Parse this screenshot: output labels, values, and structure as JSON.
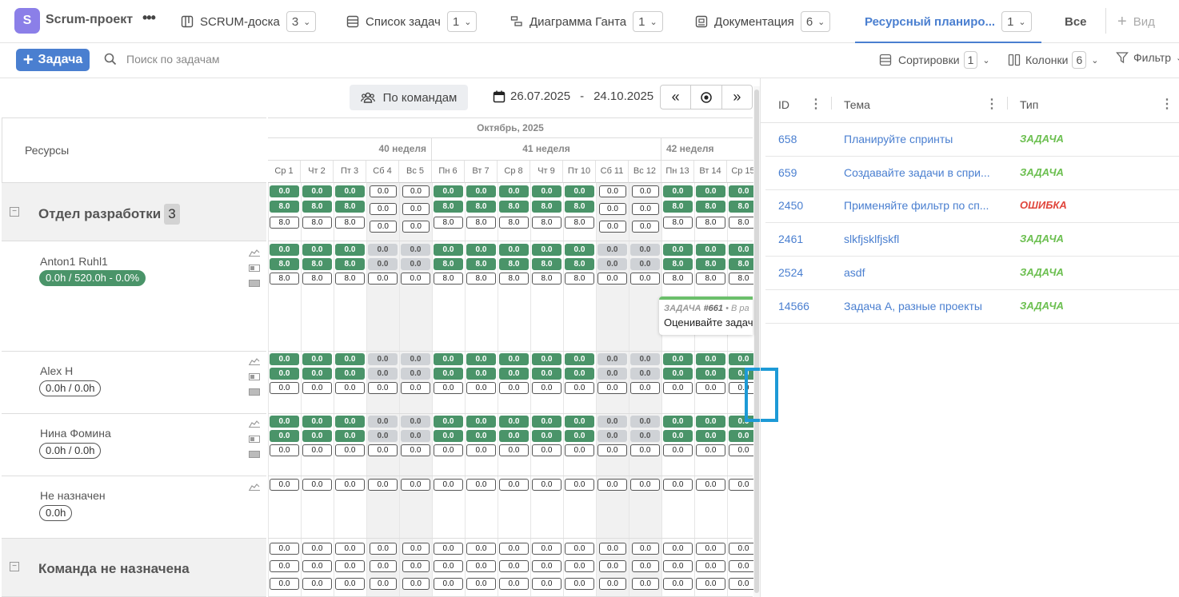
{
  "project": {
    "icon": "S",
    "name": "Scrum-проект",
    "more": "•••"
  },
  "tabs": [
    {
      "label": "SCRUM-доска",
      "count": "3",
      "icon": "board-icon"
    },
    {
      "label": "Список задач",
      "count": "1",
      "icon": "list-icon"
    },
    {
      "label": "Диаграмма Ганта",
      "count": "1",
      "icon": "gantt-icon"
    },
    {
      "label": "Документация",
      "count": "6",
      "icon": "docs-icon"
    },
    {
      "label": "Ресурсный планиро...",
      "count": "1",
      "icon": "",
      "active": true
    }
  ],
  "tab_all": "Все",
  "tab_view": "Вид",
  "toolbar": {
    "add_label": "Задача",
    "search_placeholder": "Поиск по задачам",
    "sort_label": "Сортировки",
    "sort_count": "1",
    "columns_label": "Колонки",
    "columns_count": "6",
    "filter_label": "Фильтр"
  },
  "planner": {
    "group_btn": "По командам",
    "date_from": "26.07.2025",
    "date_sep": "-",
    "date_to": "24.10.2025",
    "resources_label": "Ресурсы",
    "month": "Октябрь, 2025",
    "weeks": [
      "40 неделя",
      "41 неделя",
      "42 неделя"
    ],
    "days": [
      "Ср 1",
      "Чт 2",
      "Пт 3",
      "Сб 4",
      "Вс 5",
      "Пн 6",
      "Вт 7",
      "Ср 8",
      "Чт 9",
      "Пт 10",
      "Сб 11",
      "Вс 12",
      "Пн 13",
      "Вт 14",
      "Ср 15"
    ],
    "dept_name": "Отдел разработки",
    "dept_count": "3",
    "people": [
      {
        "name": "Anton1 Ruhl1",
        "load": "0.0h / 520.0h - 0.0%"
      },
      {
        "name": "Alex H",
        "load": "0.0h / 0.0h"
      },
      {
        "name": "Нина Фомина",
        "load": "0.0h / 0.0h"
      },
      {
        "name": "Не назначен",
        "load": "0.0h"
      }
    ],
    "no_team": "Команда не назначена",
    "popup": {
      "type": "ЗАДАЧА",
      "num": "#661",
      "status": "• В ра",
      "title": "Оценивайте задач"
    }
  },
  "tasks": {
    "headers": {
      "id": "ID",
      "topic": "Тема",
      "type": "Тип"
    },
    "rows": [
      {
        "id": "658",
        "topic": "Планируйте спринты",
        "type": "ЗАДАЧА"
      },
      {
        "id": "659",
        "topic": "Создавайте задачи в спри...",
        "type": "ЗАДАЧА"
      },
      {
        "id": "2450",
        "topic": "Применяйте фильтр по сп...",
        "type": "ОШИБКА"
      },
      {
        "id": "2461",
        "topic": "slkfjsklfjskfl",
        "type": "ЗАДАЧА"
      },
      {
        "id": "2524",
        "topic": "asdf",
        "type": "ЗАДАЧА"
      },
      {
        "id": "14566",
        "topic": "Задача А, разные проекты",
        "type": "ЗАДАЧА"
      }
    ]
  },
  "colors": {
    "accent": "#4a7fd0",
    "green": "#4a9469",
    "task_type": "#6bbf4f",
    "bug_type": "#e0453b"
  }
}
